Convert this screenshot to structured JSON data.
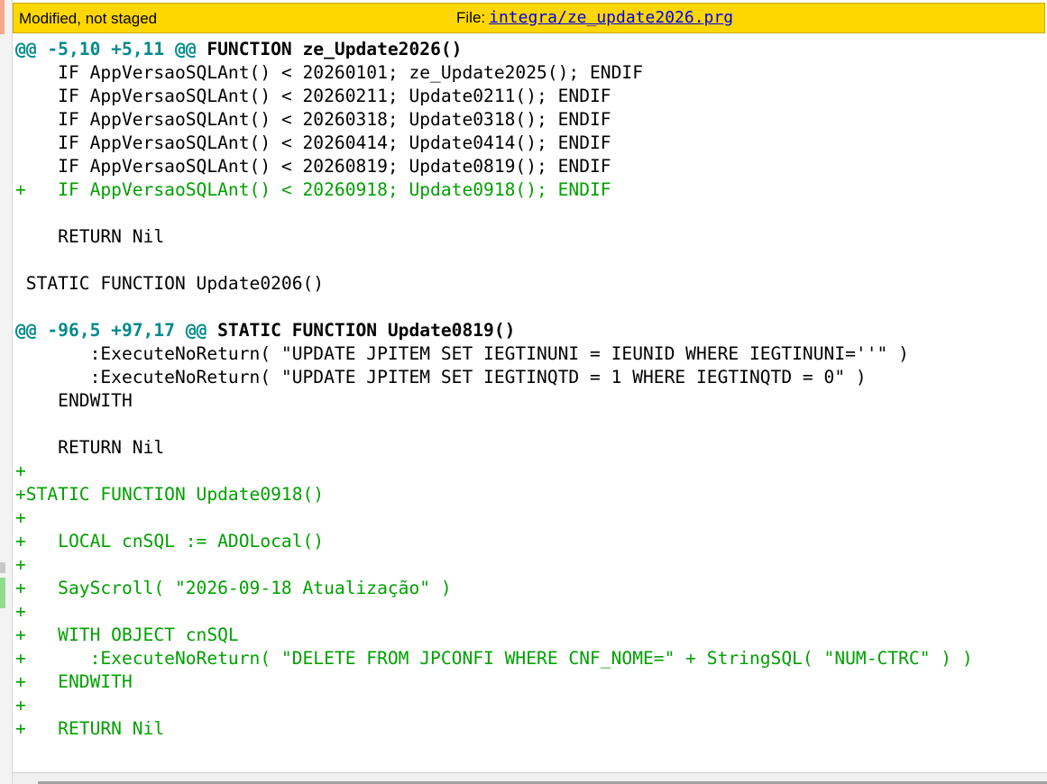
{
  "header": {
    "status": "Modified, not staged",
    "file_label": "File:",
    "file_path": "integra/ze_update2026.prg",
    "bg_color": "#ffd700"
  },
  "diff": {
    "colors": {
      "added": "#00a000",
      "hunk": "#008b8b",
      "context": "#000000"
    },
    "lines": [
      {
        "type": "hunk",
        "range": "@@ -5,10 +5,11 @@",
        "text": " FUNCTION ze_Update2026()"
      },
      {
        "type": "context",
        "text": "    IF AppVersaoSQLAnt() < 20260101; ze_Update2025(); ENDIF"
      },
      {
        "type": "context",
        "text": "    IF AppVersaoSQLAnt() < 20260211; Update0211(); ENDIF"
      },
      {
        "type": "context",
        "text": "    IF AppVersaoSQLAnt() < 20260318; Update0318(); ENDIF"
      },
      {
        "type": "context",
        "text": "    IF AppVersaoSQLAnt() < 20260414; Update0414(); ENDIF"
      },
      {
        "type": "context",
        "text": "    IF AppVersaoSQLAnt() < 20260819; Update0819(); ENDIF"
      },
      {
        "type": "added",
        "text": "+   IF AppVersaoSQLAnt() < 20260918; Update0918(); ENDIF"
      },
      {
        "type": "context",
        "text": ""
      },
      {
        "type": "context",
        "text": "    RETURN Nil"
      },
      {
        "type": "context",
        "text": ""
      },
      {
        "type": "context",
        "text": " STATIC FUNCTION Update0206()"
      },
      {
        "type": "context",
        "text": ""
      },
      {
        "type": "hunk",
        "range": "@@ -96,5 +97,17 @@",
        "text": " STATIC FUNCTION Update0819()"
      },
      {
        "type": "context",
        "text": "       :ExecuteNoReturn( \"UPDATE JPITEM SET IEGTINUNI = IEUNID WHERE IEGTINUNI=''\" )"
      },
      {
        "type": "context",
        "text": "       :ExecuteNoReturn( \"UPDATE JPITEM SET IEGTINQTD = 1 WHERE IEGTINQTD = 0\" )"
      },
      {
        "type": "context",
        "text": "    ENDWITH"
      },
      {
        "type": "context",
        "text": ""
      },
      {
        "type": "context",
        "text": "    RETURN Nil"
      },
      {
        "type": "added",
        "text": "+"
      },
      {
        "type": "added",
        "text": "+STATIC FUNCTION Update0918()"
      },
      {
        "type": "added",
        "text": "+"
      },
      {
        "type": "added",
        "text": "+   LOCAL cnSQL := ADOLocal()"
      },
      {
        "type": "added",
        "text": "+"
      },
      {
        "type": "added",
        "text": "+   SayScroll( \"2026-09-18 Atualização\" )"
      },
      {
        "type": "added",
        "text": "+"
      },
      {
        "type": "added",
        "text": "+   WITH OBJECT cnSQL"
      },
      {
        "type": "added",
        "text": "+      :ExecuteNoReturn( \"DELETE FROM JPCONFI WHERE CNF_NOME=\" + StringSQL( \"NUM-CTRC\" ) )"
      },
      {
        "type": "added",
        "text": "+   ENDWITH"
      },
      {
        "type": "added",
        "text": "+"
      },
      {
        "type": "added",
        "text": "+   RETURN Nil"
      }
    ]
  }
}
